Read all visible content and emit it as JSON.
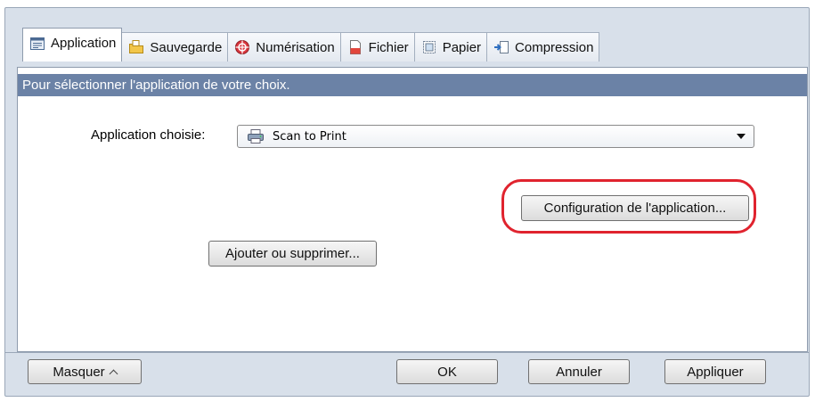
{
  "tabs": [
    {
      "label": "Application",
      "icon": "application-icon",
      "active": true
    },
    {
      "label": "Sauvegarde",
      "icon": "folder-icon"
    },
    {
      "label": "Numérisation",
      "icon": "scan-icon"
    },
    {
      "label": "Fichier",
      "icon": "file-icon"
    },
    {
      "label": "Papier",
      "icon": "paper-icon"
    },
    {
      "label": "Compression",
      "icon": "compression-icon"
    }
  ],
  "panel": {
    "info": "Pour sélectionner l'application de votre choix.",
    "app_label": "Application choisie:",
    "app_selected": "Scan to Print",
    "config_button": "Configuration de l'application...",
    "add_remove_button": "Ajouter ou supprimer..."
  },
  "footer": {
    "hide_button": "Masquer",
    "ok_button": "OK",
    "cancel_button": "Annuler",
    "apply_button": "Appliquer"
  },
  "colors": {
    "infobar": "#6b82a6",
    "highlight": "#e0232e",
    "window_bg": "#d8e0ea"
  }
}
